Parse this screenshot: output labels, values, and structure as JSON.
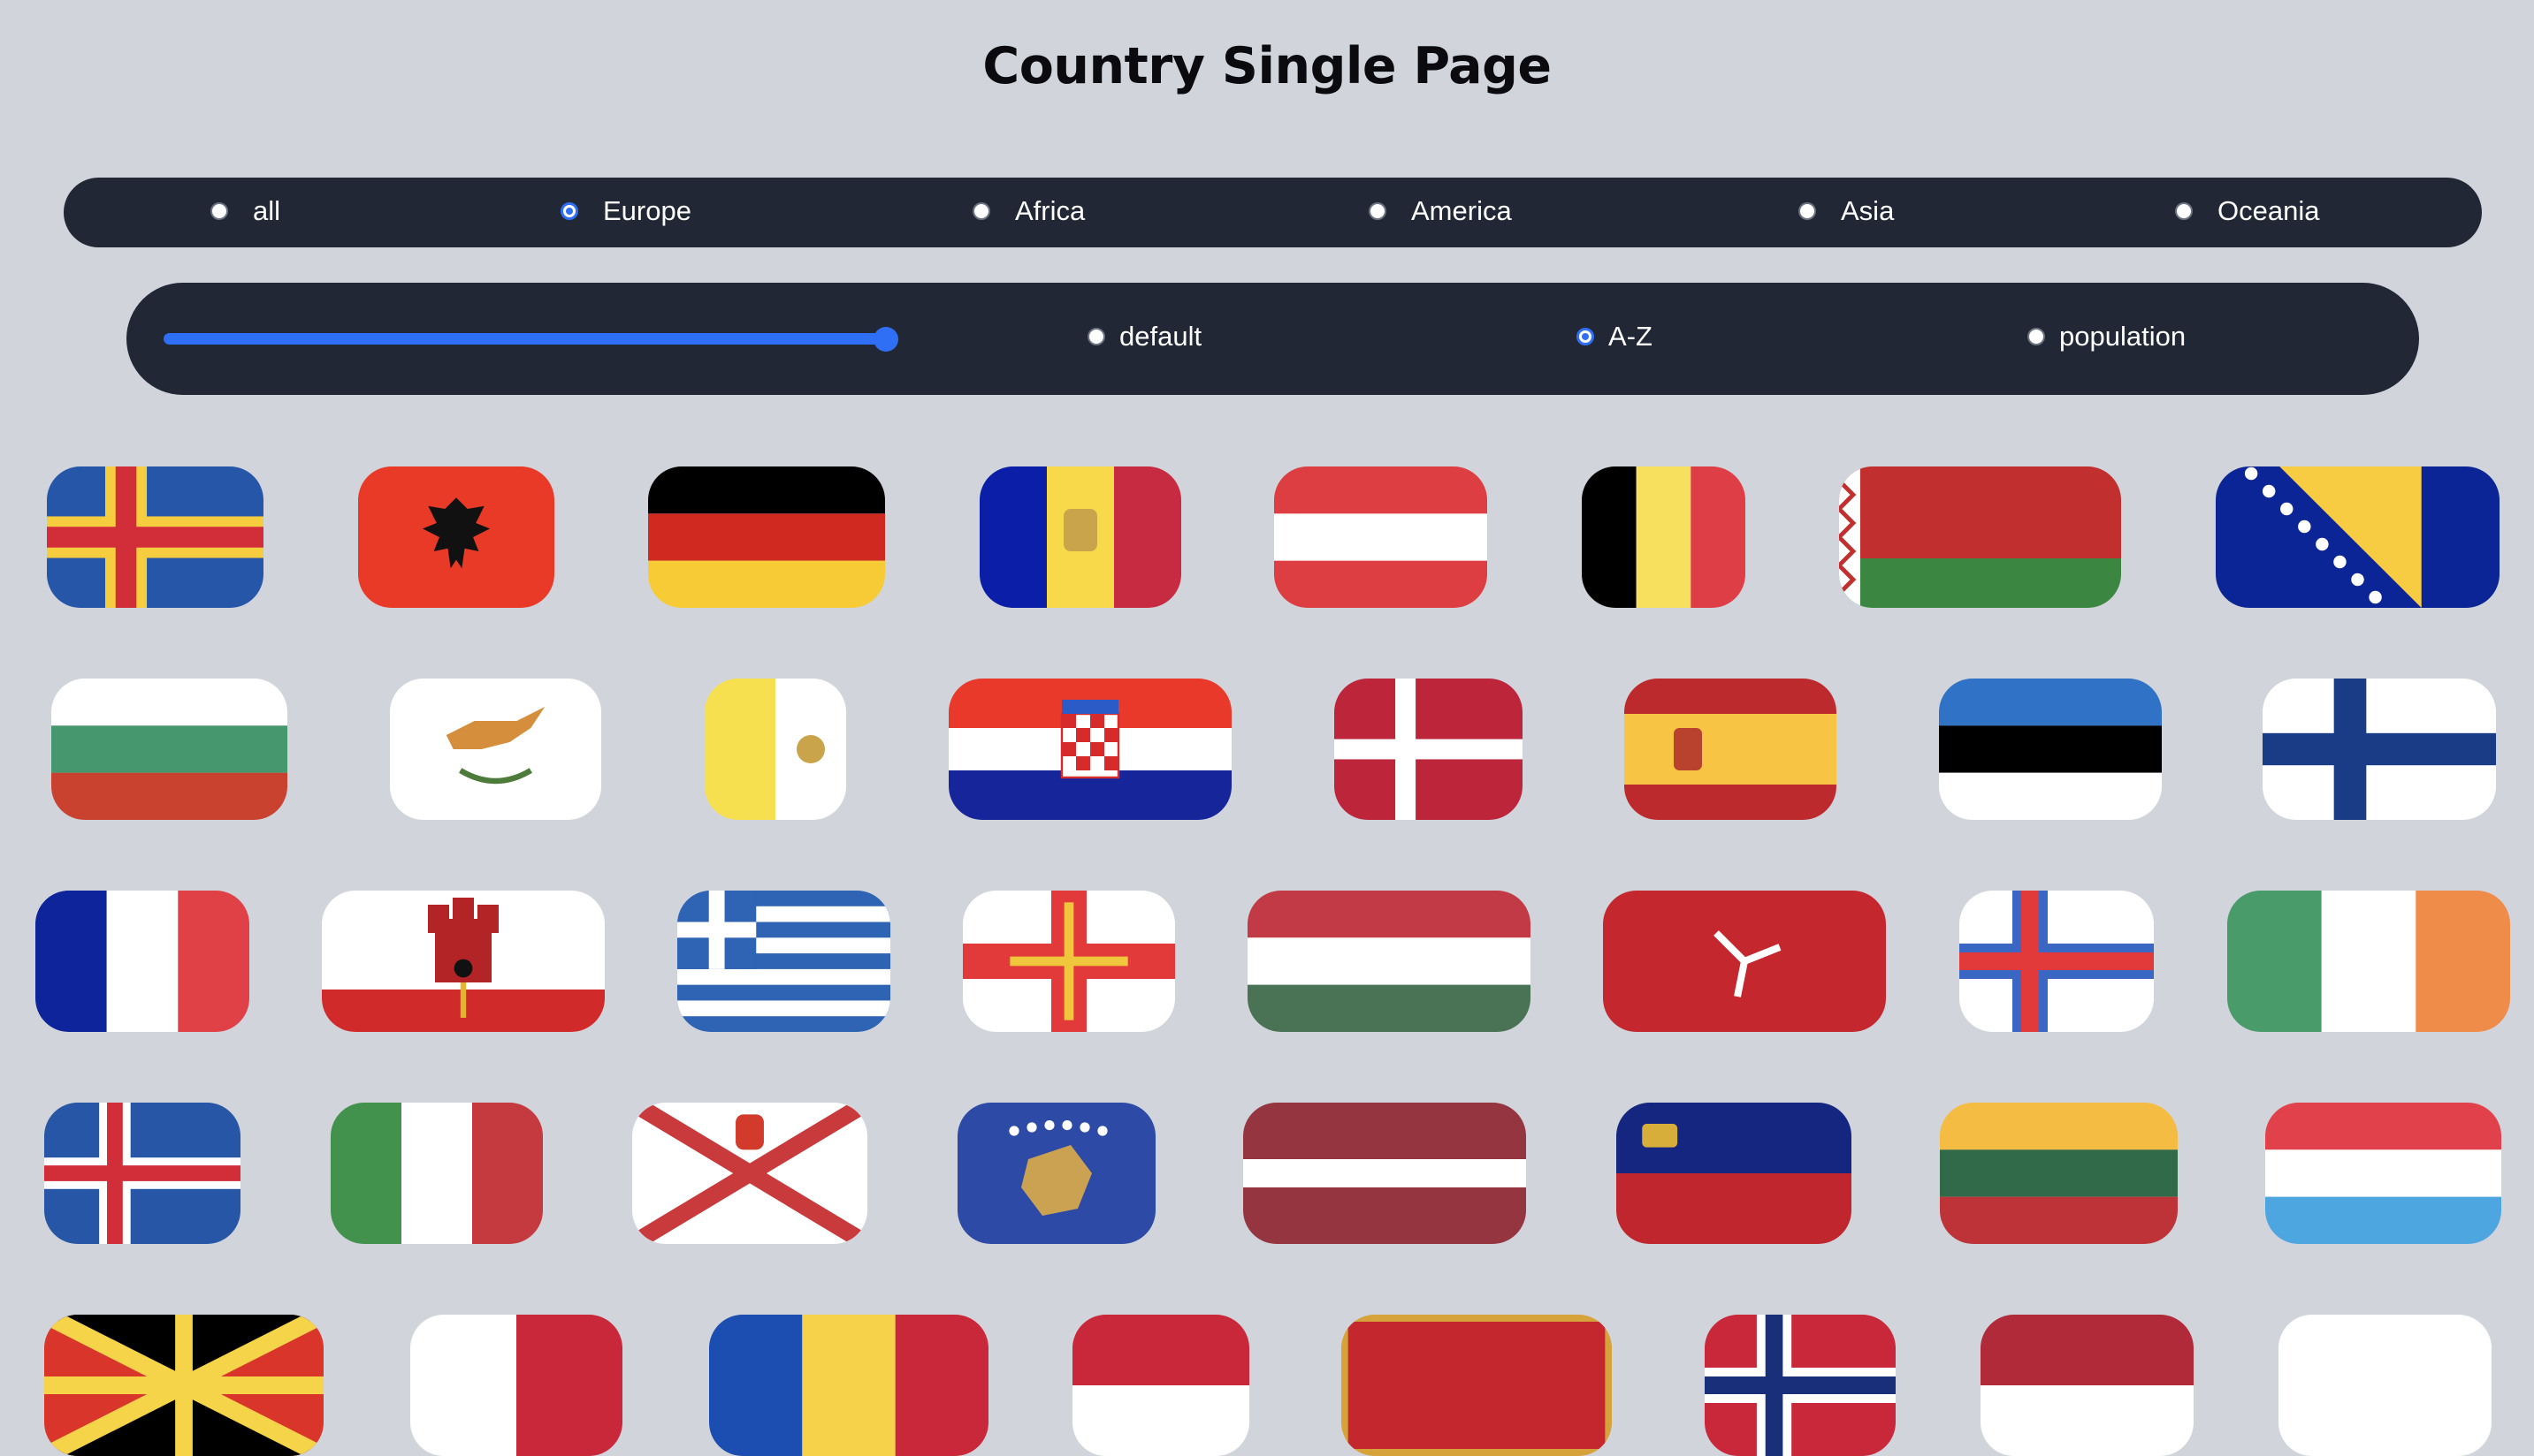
{
  "title": "Country Single Page",
  "regions": {
    "options": [
      "all",
      "Europe",
      "Africa",
      "America",
      "Asia",
      "Oceania"
    ],
    "selected": "Europe"
  },
  "sort": {
    "slider_value": 1.0,
    "options": [
      "default",
      "A-Z",
      "population"
    ],
    "selected": "A-Z"
  },
  "flags": [
    "aland-flag",
    "albania-flag",
    "germany-flag",
    "andorra-flag",
    "austria-flag",
    "belgium-flag",
    "belarus-flag",
    "bosnia-flag",
    "bulgaria-flag",
    "cyprus-flag",
    "vatican-flag",
    "croatia-flag",
    "denmark-flag",
    "spain-flag",
    "estonia-flag",
    "finland-flag",
    "france-flag",
    "gibraltar-flag",
    "greece-flag",
    "guernsey-flag",
    "hungary-flag",
    "isle-of-man-flag",
    "faroe-flag",
    "ireland-flag",
    "iceland-flag",
    "italy-flag",
    "jersey-flag",
    "kosovo-flag",
    "latvia-flag",
    "liechtenstein-flag",
    "lithuania-flag",
    "luxembourg-flag"
  ]
}
